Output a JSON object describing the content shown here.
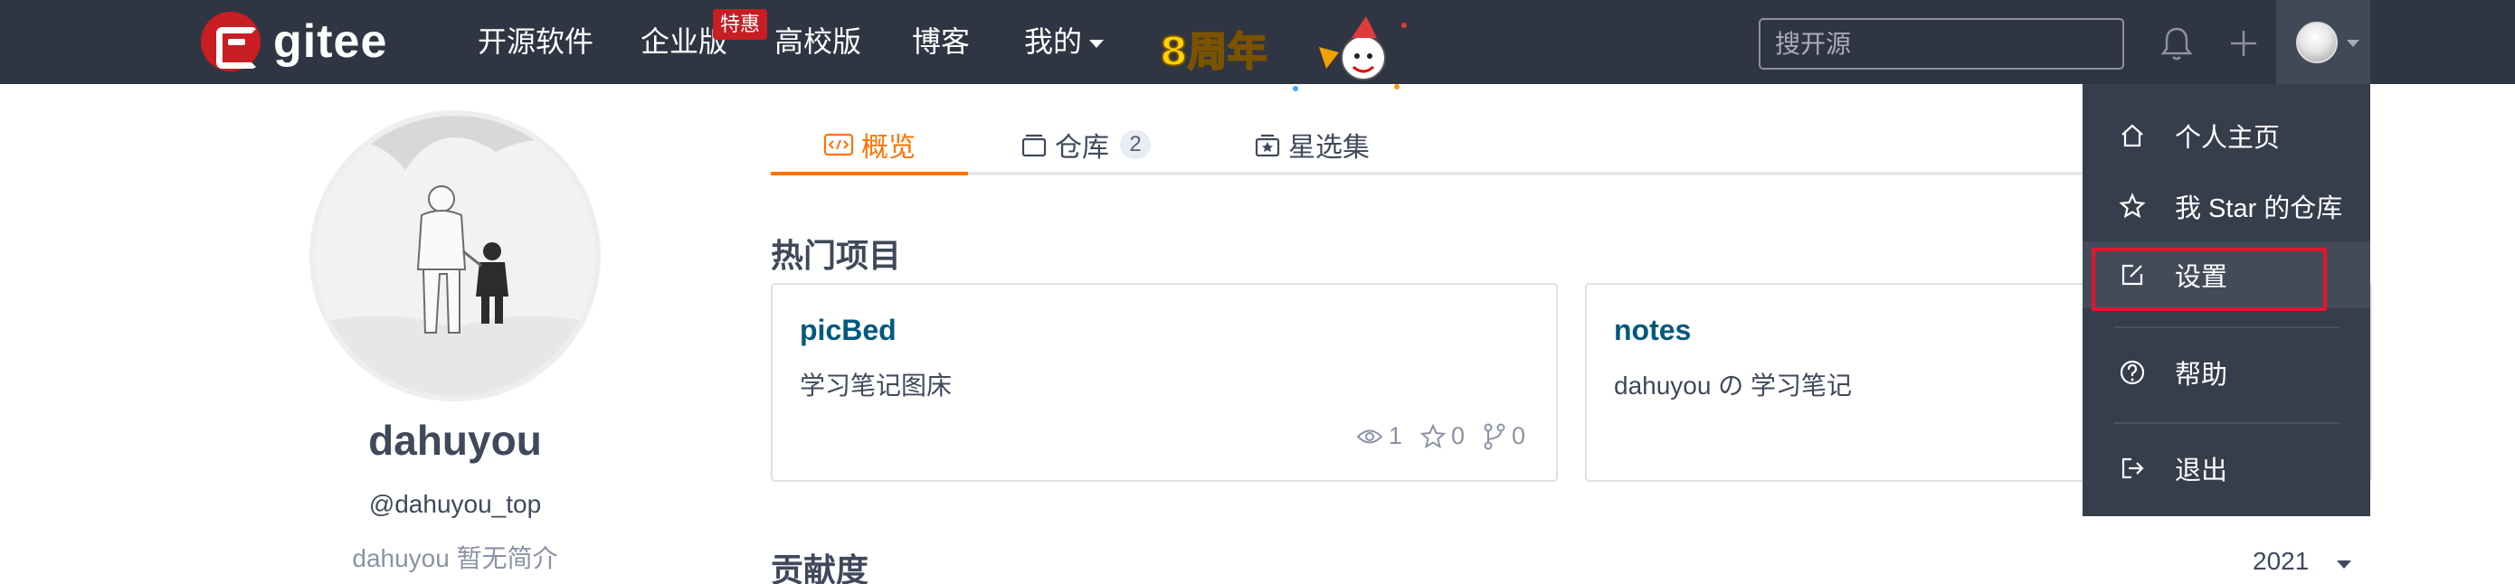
{
  "navbar": {
    "logo_text": "gitee",
    "items": [
      {
        "label": "开源软件"
      },
      {
        "label": "企业版"
      },
      {
        "label": "高校版"
      },
      {
        "label": "博客"
      },
      {
        "label": "我的"
      }
    ],
    "enterprise_badge": "特惠",
    "anniversary_text": "8周年",
    "search_placeholder": "搜开源",
    "bg_color": "#2f3542"
  },
  "profile": {
    "name": "dahuyou",
    "handle": "@dahuyou_top",
    "bio": "dahuyou 暂无简介"
  },
  "tabs": [
    {
      "label": "概览",
      "active": true
    },
    {
      "label": "仓库",
      "count": "2"
    },
    {
      "label": "星选集"
    }
  ],
  "hot_projects": {
    "title": "热门项目",
    "cards": [
      {
        "name": "picBed",
        "desc": "学习笔记图床",
        "watch": "1",
        "star": "0",
        "fork": "0"
      },
      {
        "name": "notes",
        "desc": "dahuyou の 学习笔记"
      }
    ]
  },
  "contribution": {
    "title": "贡献度",
    "year": "2021"
  },
  "user_menu": {
    "items": [
      {
        "label": "个人主页",
        "icon": "home-icon"
      },
      {
        "label": "我 Star 的仓库",
        "icon": "star-icon"
      },
      {
        "label": "设置",
        "icon": "edit-icon",
        "selected": true
      },
      {
        "label": "帮助",
        "icon": "help-icon"
      },
      {
        "label": "退出",
        "icon": "logout-icon"
      }
    ]
  },
  "colors": {
    "accent": "#fe7300",
    "brand": "#c71d23",
    "link": "#005980",
    "highlight": "#e5152c"
  }
}
